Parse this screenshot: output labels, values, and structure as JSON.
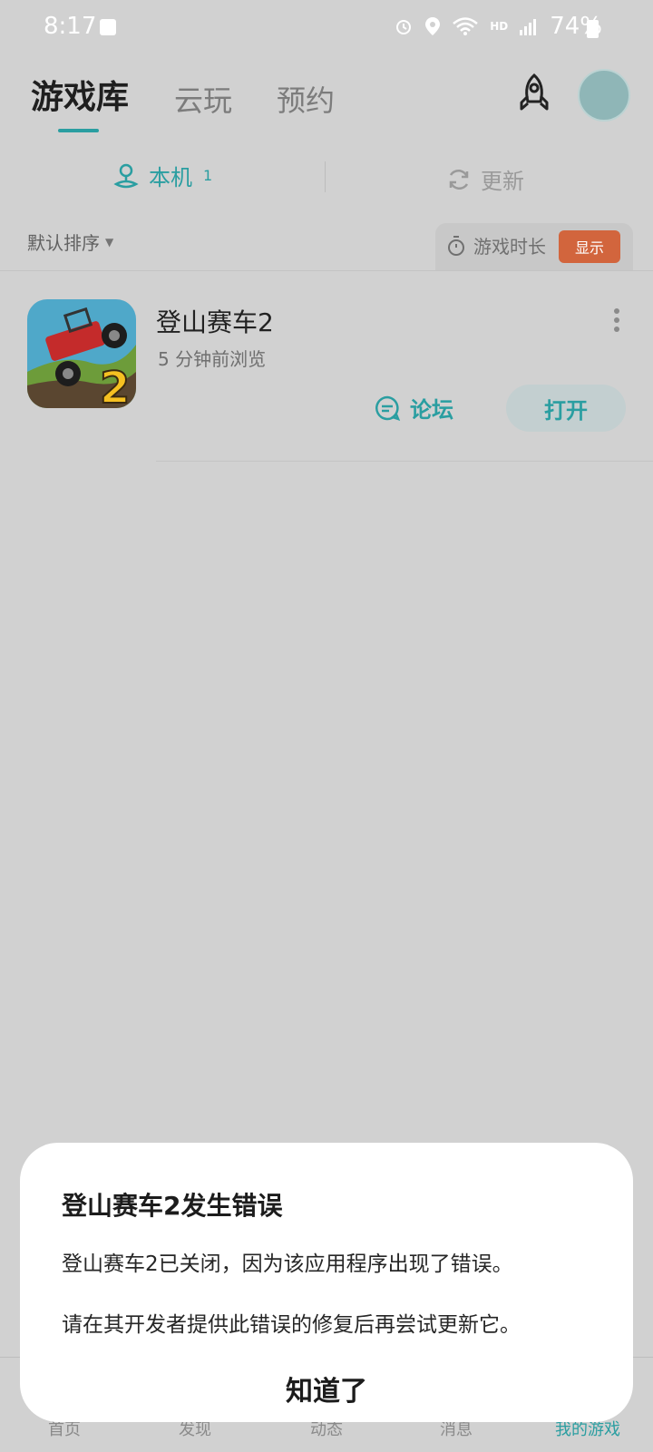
{
  "status_bar": {
    "time": "8:17",
    "battery": "74%",
    "network_badge": "HD"
  },
  "header": {
    "tabs": [
      {
        "label": "游戏库",
        "active": true
      },
      {
        "label": "云玩",
        "active": false
      },
      {
        "label": "预约",
        "active": false
      }
    ],
    "accent_color": "#2a9ea1"
  },
  "segments": {
    "local_label": "本机",
    "local_count": "1",
    "update_label": "更新"
  },
  "sort": {
    "label": "默认排序"
  },
  "playtime": {
    "label": "游戏时长",
    "button": "显示"
  },
  "game": {
    "title": "登山赛车2",
    "subtitle": "5 分钟前浏览",
    "forum_label": "论坛",
    "open_label": "打开",
    "icon_badge": "2"
  },
  "bottom_nav": [
    "首页",
    "发现",
    "动态",
    "消息",
    "我的游戏"
  ],
  "dialog": {
    "title": "登山赛车2发生错误",
    "line1": "登山赛车2已关闭，因为该应用程序出现了错误。",
    "line2": "请在其开发者提供此错误的修复后再尝试更新它。",
    "ok_label": "知道了"
  }
}
